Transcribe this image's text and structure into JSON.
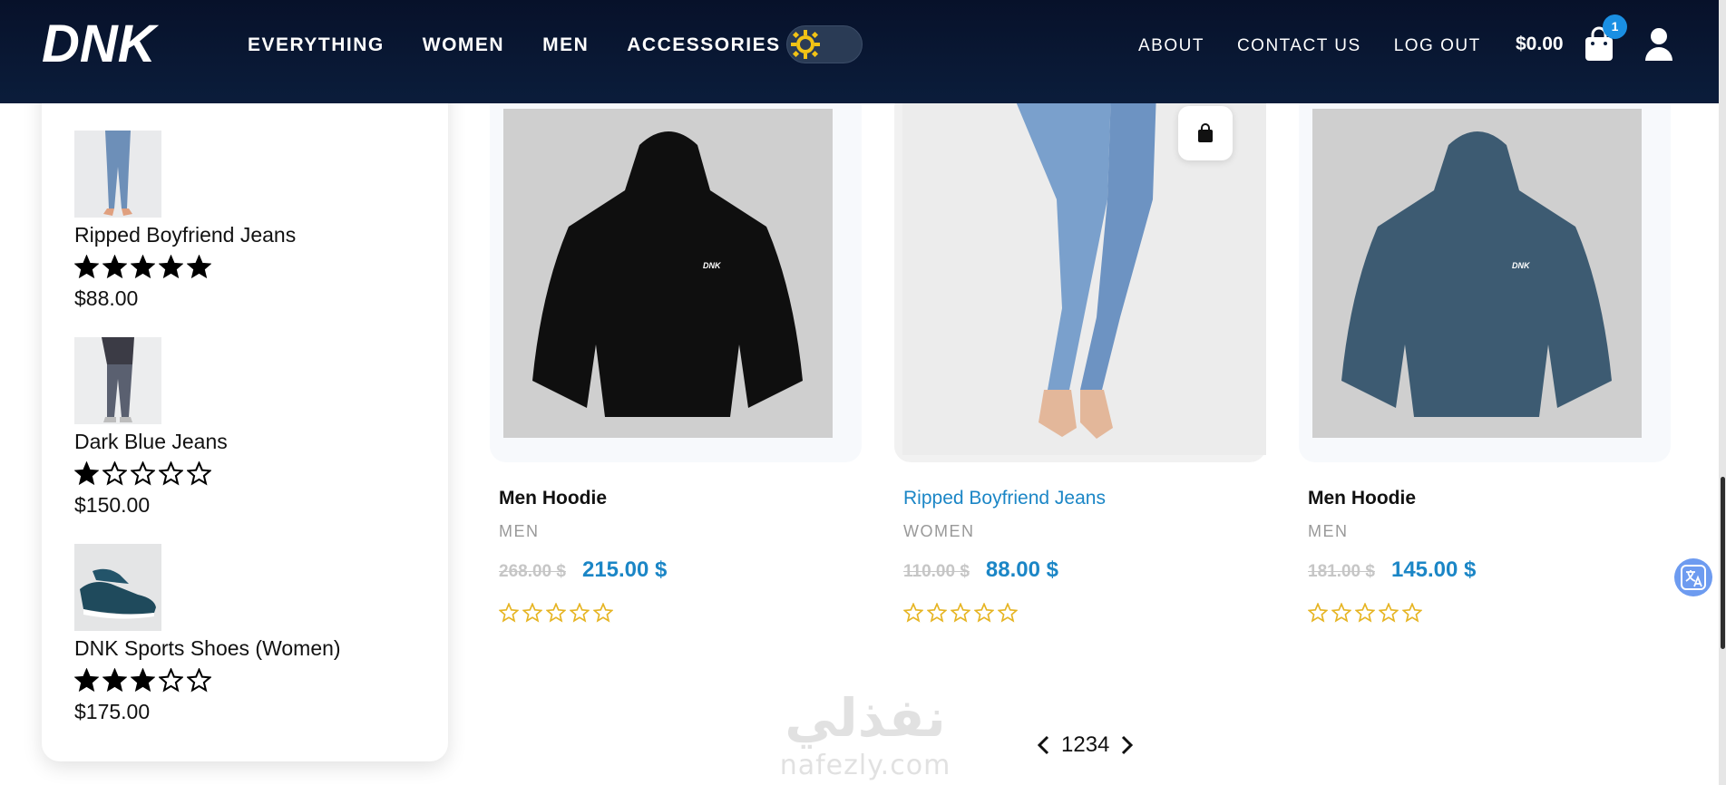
{
  "header": {
    "logo_text": "DNK",
    "nav": [
      "EVERYTHING",
      "WOMEN",
      "MEN",
      "ACCESSORIES"
    ],
    "theme_toggle_icon": "sun-icon",
    "right_nav": [
      "ABOUT",
      "CONTACT US",
      "LOG OUT"
    ],
    "cart_total": "$0.00",
    "cart_count": "1",
    "cart_icon": "shopping-bag-icon",
    "account_icon": "user-icon",
    "colors": {
      "bg": "#07112a",
      "badge": "#1a8fe3",
      "toggle_sun": "#f2c315"
    }
  },
  "sidebar": {
    "items": [
      {
        "name": "Ripped Boyfriend Jeans",
        "rating": 5,
        "price": "$88.00",
        "thumb_icon": "jeans-thumbnail"
      },
      {
        "name": "Dark Blue Jeans",
        "rating": 1,
        "price": "$150.00",
        "thumb_icon": "jeans-thumbnail"
      },
      {
        "name": "DNK Sports Shoes (Women)",
        "rating": 3,
        "price": "$175.00",
        "thumb_icon": "shoes-thumbnail"
      }
    ]
  },
  "products": [
    {
      "title": "Men Hoodie",
      "category": "MEN",
      "old_price": "268.00 $",
      "price": "215.00 $",
      "rating": 0,
      "image": "black-hoodie-image",
      "image_logo": "DNK"
    },
    {
      "title": "Ripped Boyfriend Jeans",
      "category": "WOMEN",
      "old_price": "110.00 $",
      "price": "88.00 $",
      "rating": 0,
      "image": "jeans-image",
      "quick_add_icon": "shopping-bag-icon"
    },
    {
      "title": "Men Hoodie",
      "category": "MEN",
      "old_price": "181.00 $",
      "price": "145.00 $",
      "rating": 0,
      "image": "blue-hoodie-image",
      "image_logo": "DNK"
    }
  ],
  "pagination": {
    "pages": "1234",
    "prev_icon": "chevron-left-icon",
    "next_icon": "chevron-right-icon"
  },
  "watermark": {
    "arabic": "نفذلي",
    "latin": "nafezly.com"
  },
  "colors": {
    "accent": "#1b86c6",
    "star_outline": "#e6b422"
  }
}
